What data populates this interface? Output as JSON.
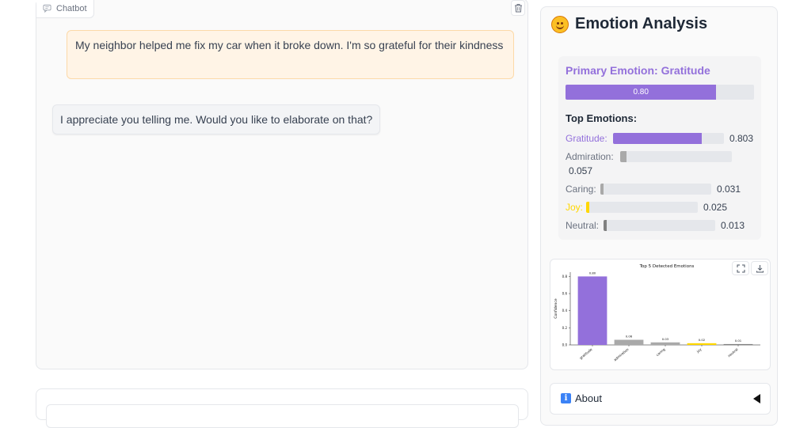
{
  "chat": {
    "label": "Chatbot",
    "messages": [
      {
        "role": "user",
        "text": "My neighbor helped me fix my car when it broke down. I'm so grateful for their kindness"
      },
      {
        "role": "bot",
        "text": "I appreciate you telling me. Would you like to elaborate on that?"
      }
    ]
  },
  "sidebar": {
    "title": "Emotion Analysis",
    "title_icon": "smiling-face-icon",
    "primary": {
      "label": "Primary Emotion: Gratitude",
      "bar_text": "0.80",
      "fraction": 0.8,
      "color": "#9370db"
    },
    "top_title": "Top Emotions:",
    "emotions": [
      {
        "name": "Gratitude:",
        "value": "0.803",
        "score": 0.803,
        "color": "#9370db"
      },
      {
        "name": "Admiration:",
        "value": "0.057",
        "score": 0.057,
        "color": "#a9a9a9"
      },
      {
        "name": "Caring:",
        "value": "0.031",
        "score": 0.031,
        "color": "#a9a9a9"
      },
      {
        "name": "Joy:",
        "value": "0.025",
        "score": 0.025,
        "color": "#ffd700"
      },
      {
        "name": "Neutral:",
        "value": "0.013",
        "score": 0.013,
        "color": "#808080"
      }
    ],
    "about_label": "About",
    "about_icon": "info-icon"
  },
  "chart_data": {
    "type": "bar",
    "title": "Top 5 Detected Emotions",
    "ylabel": "Confidence",
    "xlabel": "",
    "categories": [
      "gratitude",
      "admiration",
      "caring",
      "joy",
      "neutral"
    ],
    "values": [
      0.8,
      0.06,
      0.03,
      0.02,
      0.01
    ],
    "value_labels": [
      "0.80",
      "0.06",
      "0.03",
      "0.02",
      "0.01"
    ],
    "colors": [
      "#9370db",
      "#a9a9a9",
      "#a9a9a9",
      "#ffd700",
      "#808080"
    ],
    "yticks": [
      "0.0",
      "0.2",
      "0.4",
      "0.6",
      "0.8"
    ],
    "ylim": [
      0,
      0.85
    ],
    "grid": false
  }
}
